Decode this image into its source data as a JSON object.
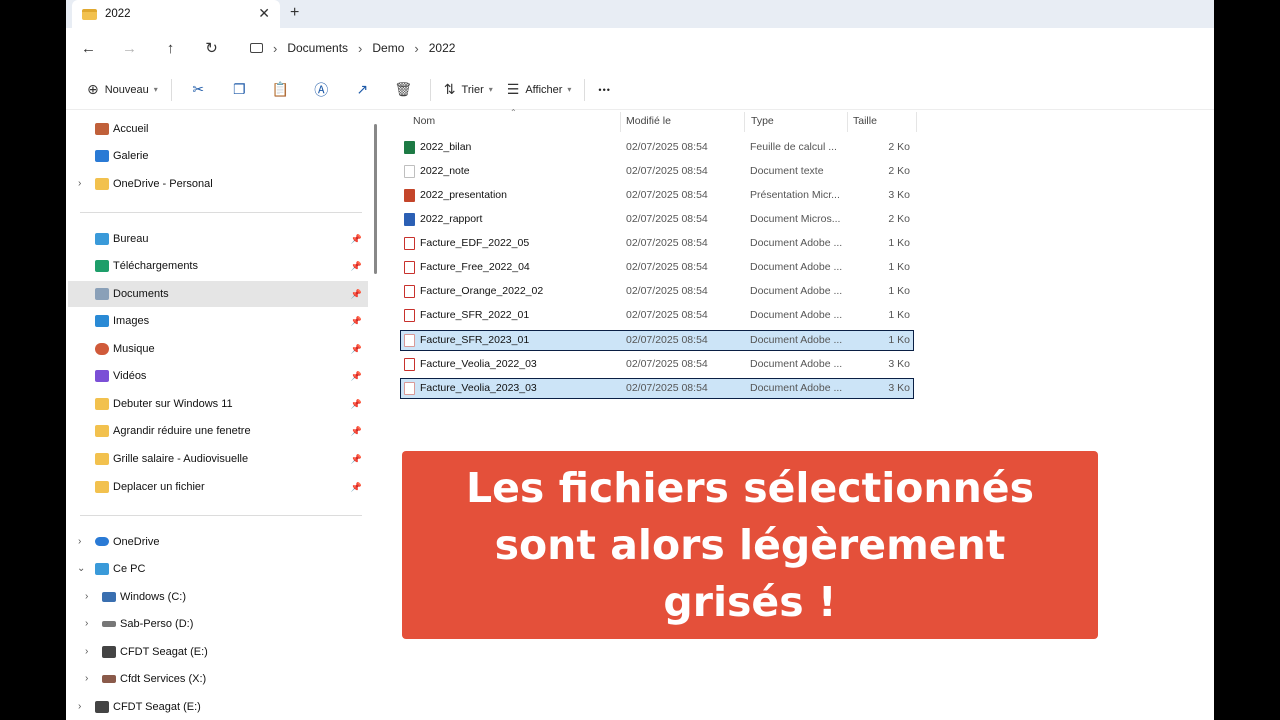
{
  "window": {
    "tab_title": "2022",
    "tab_close": "✕",
    "new_tab": "+"
  },
  "nav": {
    "back": "←",
    "forward": "→",
    "up": "↑",
    "refresh": "↻",
    "breadcrumbs": [
      "Documents",
      "Demo",
      "2022"
    ]
  },
  "toolbar": {
    "new_label": "Nouveau",
    "sort_label": "Trier",
    "view_label": "Afficher",
    "more_label": "•••"
  },
  "sidebar": {
    "items": [
      {
        "label": "Accueil",
        "icon": "home-icon",
        "color": "#c0603a"
      },
      {
        "label": "Galerie",
        "icon": "gallery-icon",
        "color": "#2a7ad5"
      },
      {
        "label": "OneDrive - Personal",
        "icon": "folder-icon",
        "color": "#f2c14e"
      },
      {
        "label": "Bureau",
        "icon": "desktop-icon",
        "color": "#3a9ad9"
      },
      {
        "label": "Téléchargements",
        "icon": "download-icon",
        "color": "#1e9e6a"
      },
      {
        "label": "Documents",
        "icon": "documents-icon",
        "color": "#8aa0b8"
      },
      {
        "label": "Images",
        "icon": "images-icon",
        "color": "#2a8ad5"
      },
      {
        "label": "Musique",
        "icon": "music-icon",
        "color": "#d05a3a"
      },
      {
        "label": "Vidéos",
        "icon": "videos-icon",
        "color": "#7b4fd6"
      },
      {
        "label": "Debuter sur Windows 11",
        "icon": "folder-icon",
        "color": "#f2c14e"
      },
      {
        "label": "Agrandir réduire une fenetre",
        "icon": "folder-icon",
        "color": "#f2c14e"
      },
      {
        "label": "Grille salaire - Audiovisuelle",
        "icon": "folder-icon",
        "color": "#f2c14e"
      },
      {
        "label": "Deplacer un fichier",
        "icon": "folder-icon",
        "color": "#f2c14e"
      },
      {
        "label": "OneDrive",
        "icon": "cloud-icon",
        "color": "#2a7ad5"
      },
      {
        "label": "Ce PC",
        "icon": "pc-icon",
        "color": "#3a9ad9"
      },
      {
        "label": "Windows (C:)",
        "icon": "drive-icon",
        "color": "#3a6fb0"
      },
      {
        "label": "Sab-Perso (D:)",
        "icon": "drive-icon",
        "color": "#777777"
      },
      {
        "label": "CFDT Seagat (E:)",
        "icon": "drive-icon",
        "color": "#444444"
      },
      {
        "label": "Cfdt Services (X:)",
        "icon": "network-drive-icon",
        "color": "#8a5a4a"
      },
      {
        "label": "CFDT Seagat (E:)",
        "icon": "drive-icon",
        "color": "#444444"
      }
    ]
  },
  "columns": {
    "name": "Nom",
    "modified": "Modifié le",
    "type": "Type",
    "size": "Taille"
  },
  "files": [
    {
      "name": "2022_bilan",
      "date": "02/07/2025 08:54",
      "type": "Feuille de calcul ...",
      "size": "2 Ko",
      "icon": "excel-icon",
      "color": "#1d7a44"
    },
    {
      "name": "2022_note",
      "date": "02/07/2025 08:54",
      "type": "Document texte",
      "size": "2 Ko",
      "icon": "text-file-icon",
      "color": "#bfbfbf"
    },
    {
      "name": "2022_presentation",
      "date": "02/07/2025 08:54",
      "type": "Présentation Micr...",
      "size": "3 Ko",
      "icon": "powerpoint-icon",
      "color": "#c4452a"
    },
    {
      "name": "2022_rapport",
      "date": "02/07/2025 08:54",
      "type": "Document Micros...",
      "size": "2 Ko",
      "icon": "word-icon",
      "color": "#2b5fb4"
    },
    {
      "name": "Facture_EDF_2022_05",
      "date": "02/07/2025 08:54",
      "type": "Document Adobe ...",
      "size": "1 Ko",
      "icon": "pdf-icon",
      "color": "#c8312c"
    },
    {
      "name": "Facture_Free_2022_04",
      "date": "02/07/2025 08:54",
      "type": "Document Adobe ...",
      "size": "1 Ko",
      "icon": "pdf-icon",
      "color": "#c8312c"
    },
    {
      "name": "Facture_Orange_2022_02",
      "date": "02/07/2025 08:54",
      "type": "Document Adobe ...",
      "size": "1 Ko",
      "icon": "pdf-icon",
      "color": "#c8312c"
    },
    {
      "name": "Facture_SFR_2022_01",
      "date": "02/07/2025 08:54",
      "type": "Document Adobe ...",
      "size": "1 Ko",
      "icon": "pdf-icon",
      "color": "#c8312c"
    },
    {
      "name": "Facture_SFR_2023_01",
      "date": "02/07/2025 08:54",
      "type": "Document Adobe ...",
      "size": "1 Ko",
      "icon": "pdf-icon",
      "color": "#d99a98",
      "selected": true
    },
    {
      "name": "Facture_Veolia_2022_03",
      "date": "02/07/2025 08:54",
      "type": "Document Adobe ...",
      "size": "3 Ko",
      "icon": "pdf-icon",
      "color": "#c8312c"
    },
    {
      "name": "Facture_Veolia_2023_03",
      "date": "02/07/2025 08:54",
      "type": "Document Adobe ...",
      "size": "3 Ko",
      "icon": "pdf-icon",
      "color": "#d99a98",
      "selected": true
    }
  ],
  "banner": {
    "text": "Les fichiers sélectionnés sont alors légèrement grisés !",
    "color": "#e4503a"
  }
}
